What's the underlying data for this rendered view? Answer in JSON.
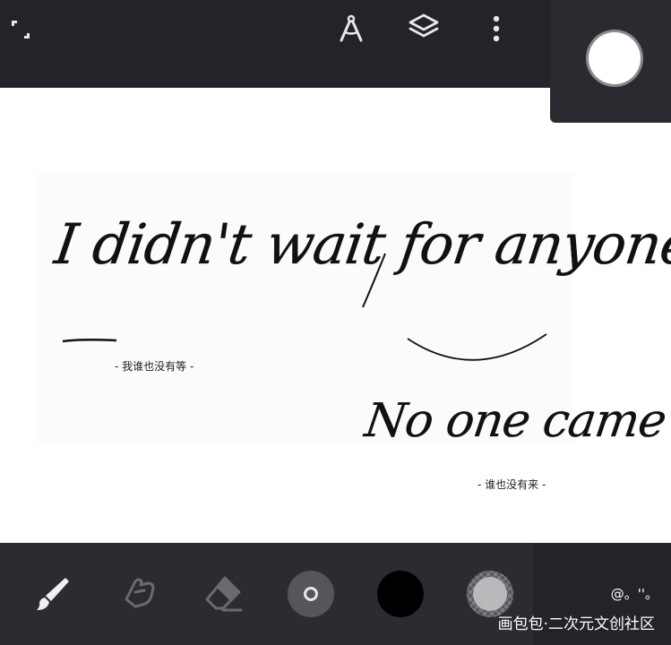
{
  "top_bar": {
    "fullscreen_icon": "fullscreen-exit-icon",
    "ruler_icon": "compass-ruler-icon",
    "layers_icon": "layers-icon",
    "menu_icon": "more-vertical-icon"
  },
  "color_panel": {
    "current_color": "#ffffff"
  },
  "canvas": {
    "handwriting_line1": "I didn't wait for anyone",
    "caption_1": "- 我谁也没有等 -",
    "handwriting_line2": "No one came",
    "caption_2": "- 谁也没有来 -"
  },
  "bottom_toolbar": {
    "tools": [
      {
        "name": "brush",
        "icon": "brush-icon"
      },
      {
        "name": "smudge",
        "icon": "smudge-icon"
      },
      {
        "name": "eraser",
        "icon": "eraser-icon"
      },
      {
        "name": "brush-size",
        "icon": "brush-size-icon"
      },
      {
        "name": "primary-color",
        "color": "#000000"
      },
      {
        "name": "secondary-color",
        "color": "#b9b9bc"
      }
    ]
  },
  "watermark": {
    "line1": "@。''。",
    "line2": "画包包·二次元文创社区"
  }
}
